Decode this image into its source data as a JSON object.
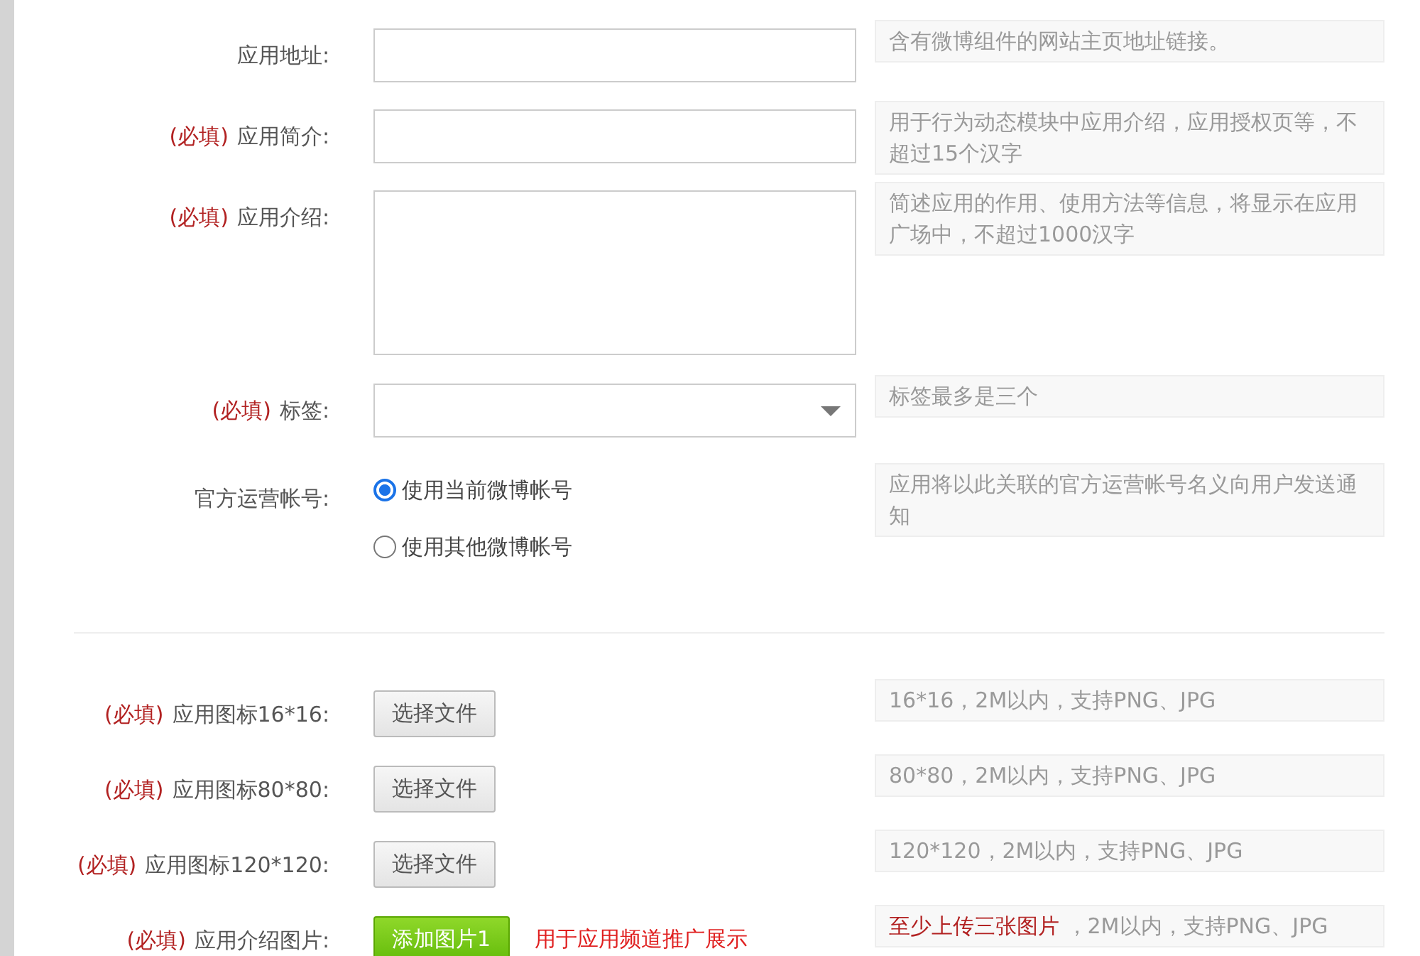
{
  "form_rows": [
    {
      "kind": "text",
      "required_mark": null,
      "label": "应用地址:",
      "hint": "含有微博组件的网站主页地址链接。"
    },
    {
      "kind": "text",
      "required_mark": "(必填)",
      "label": "应用简介:",
      "hint": "用于行为动态模块中应用介绍，应用授权页等，不超过15个汉字"
    },
    {
      "kind": "textarea",
      "required_mark": "(必填)",
      "label": "应用介绍:",
      "hint": "简述应用的作用、使用方法等信息，将显示在应用广场中，不超过1000汉字"
    },
    {
      "kind": "select",
      "required_mark": "(必填)",
      "label": "标签:",
      "hint": "标签最多是三个"
    },
    {
      "kind": "radio",
      "required_mark": null,
      "label": "官方运营帐号:",
      "hint": "应用将以此关联的官方运营帐号名义向用户发送通知",
      "options": [
        {
          "label": "使用当前微博帐号",
          "selected": true
        },
        {
          "label": "使用其他微博帐号",
          "selected": false
        }
      ]
    }
  ],
  "upload_rows": [
    {
      "kind": "file",
      "required_mark": "(必填)",
      "label": "应用图标16*16:",
      "button": "选择文件",
      "hint": "16*16，2M以内，支持PNG、JPG"
    },
    {
      "kind": "file",
      "required_mark": "(必填)",
      "label": "应用图标80*80:",
      "button": "选择文件",
      "hint": "80*80，2M以内，支持PNG、JPG"
    },
    {
      "kind": "file",
      "required_mark": "(必填)",
      "label": "应用图标120*120:",
      "button": "选择文件",
      "hint": "120*120，2M以内，支持PNG、JPG"
    },
    {
      "kind": "image",
      "required_mark": "(必填)",
      "label": "应用介绍图片:",
      "button": "添加图片1",
      "note": "用于应用频道推广展示",
      "hint_highlight": "至少上传三张图片",
      "hint": " ，2M以内，支持PNG、JPG"
    }
  ]
}
